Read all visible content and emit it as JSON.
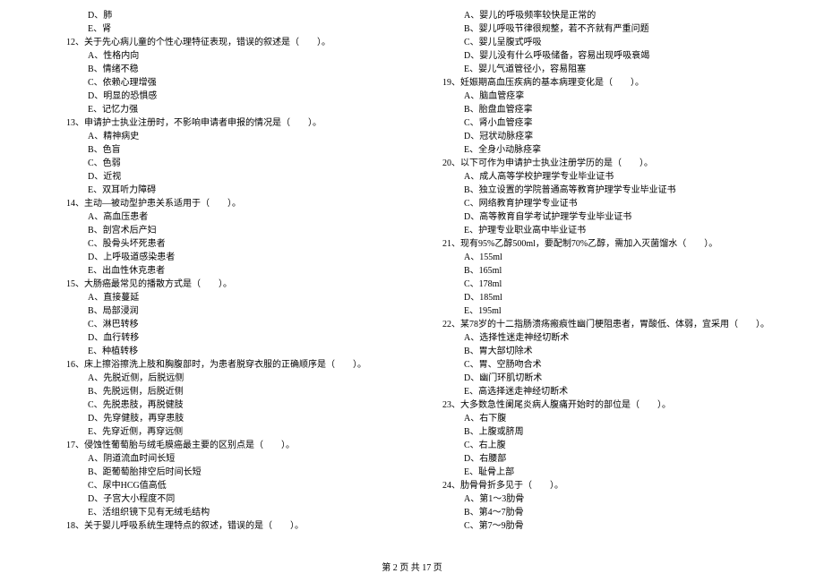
{
  "left_column": [
    {
      "type": "option",
      "text": "D、肺"
    },
    {
      "type": "option",
      "text": "E、肾"
    },
    {
      "type": "question",
      "text": "12、关于先心病儿童的个性心理特征表现，错误的叙述是（　　）。"
    },
    {
      "type": "option",
      "text": "A、性格内向"
    },
    {
      "type": "option",
      "text": "B、情绪不稳"
    },
    {
      "type": "option",
      "text": "C、依赖心理增强"
    },
    {
      "type": "option",
      "text": "D、明显的恐惧感"
    },
    {
      "type": "option",
      "text": "E、记忆力强"
    },
    {
      "type": "question",
      "text": "13、申请护士执业注册时，不影响申请者申报的情况是（　　）。"
    },
    {
      "type": "option",
      "text": "A、精神病史"
    },
    {
      "type": "option",
      "text": "B、色盲"
    },
    {
      "type": "option",
      "text": "C、色弱"
    },
    {
      "type": "option",
      "text": "D、近视"
    },
    {
      "type": "option",
      "text": "E、双耳听力障碍"
    },
    {
      "type": "question",
      "text": "14、主动—被动型护患关系适用于（　　）。"
    },
    {
      "type": "option",
      "text": "A、高血压患者"
    },
    {
      "type": "option",
      "text": "B、剖宫术后产妇"
    },
    {
      "type": "option",
      "text": "C、股骨头坏死患者"
    },
    {
      "type": "option",
      "text": "D、上呼吸道感染患者"
    },
    {
      "type": "option",
      "text": "E、出血性休克患者"
    },
    {
      "type": "question",
      "text": "15、大肠癌最常见的播散方式是（　　）。"
    },
    {
      "type": "option",
      "text": "A、直接蔓延"
    },
    {
      "type": "option",
      "text": "B、局部浸润"
    },
    {
      "type": "option",
      "text": "C、淋巴转移"
    },
    {
      "type": "option",
      "text": "D、血行转移"
    },
    {
      "type": "option",
      "text": "E、种植转移"
    },
    {
      "type": "question",
      "text": "16、床上擦浴擦洗上肢和胸腹部时，为患者脱穿衣服的正确顺序是（　　）。"
    },
    {
      "type": "option",
      "text": "A、先脱近侧，后脱远侧"
    },
    {
      "type": "option",
      "text": "B、先脱远侧，后脱近侧"
    },
    {
      "type": "option",
      "text": "C、先脱患肢，再脱健肢"
    },
    {
      "type": "option",
      "text": "D、先穿健肢，再穿患肢"
    },
    {
      "type": "option",
      "text": "E、先穿近侧，再穿远侧"
    },
    {
      "type": "question",
      "text": "17、侵蚀性葡萄胎与绒毛膜癌最主要的区别点是（　　）。"
    },
    {
      "type": "option",
      "text": "A、阴道流血时间长短"
    },
    {
      "type": "option",
      "text": "B、距葡萄胎排空后时间长短"
    },
    {
      "type": "option",
      "text": "C、尿中HCG值高低"
    },
    {
      "type": "option",
      "text": "D、子宫大小程度不同"
    },
    {
      "type": "option",
      "text": "E、活组织镜下见有无绒毛结构"
    },
    {
      "type": "question",
      "text": "18、关于婴儿呼吸系统生理特点的叙述，错误的是（　　）。"
    }
  ],
  "right_column": [
    {
      "type": "option",
      "text": "A、婴儿的呼吸频率较快是正常的"
    },
    {
      "type": "option",
      "text": "B、婴儿呼吸节律很规整，若不齐就有严重问题"
    },
    {
      "type": "option",
      "text": "C、婴儿呈腹式呼吸"
    },
    {
      "type": "option",
      "text": "D、婴儿没有什么呼吸储备，容易出现呼吸衰竭"
    },
    {
      "type": "option",
      "text": "E、婴儿气道管径小，容易阻塞"
    },
    {
      "type": "question",
      "text": "19、妊娠期高血压疾病的基本病理变化是（　　）。"
    },
    {
      "type": "option",
      "text": "A、脑血管痉挛"
    },
    {
      "type": "option",
      "text": "B、胎盘血管痉挛"
    },
    {
      "type": "option",
      "text": "C、肾小血管痉挛"
    },
    {
      "type": "option",
      "text": "D、冠状动脉痉挛"
    },
    {
      "type": "option",
      "text": "E、全身小动脉痉挛"
    },
    {
      "type": "question",
      "text": "20、以下可作为申请护士执业注册学历的是（　　）。"
    },
    {
      "type": "option",
      "text": "A、成人高等学校护理学专业毕业证书"
    },
    {
      "type": "option",
      "text": "B、独立设置的学院普通高等教育护理学专业毕业证书"
    },
    {
      "type": "option",
      "text": "C、网络教育护理学专业证书"
    },
    {
      "type": "option",
      "text": "D、高等教育自学考试护理学专业毕业证书"
    },
    {
      "type": "option",
      "text": "E、护理专业职业高中毕业证书"
    },
    {
      "type": "question",
      "text": "21、现有95%乙醇500ml，要配制70%乙醇，需加入灭菌馏水（　　）。"
    },
    {
      "type": "option",
      "text": "A、155ml"
    },
    {
      "type": "option",
      "text": "B、165ml"
    },
    {
      "type": "option",
      "text": "C、178ml"
    },
    {
      "type": "option",
      "text": "D、185ml"
    },
    {
      "type": "option",
      "text": "E、195ml"
    },
    {
      "type": "question",
      "text": "22、某78岁的十二指肠溃疡瘢痕性幽门梗阻患者，胃酸低、体弱，宜采用（　　）。"
    },
    {
      "type": "option",
      "text": "A、选择性迷走神经切断术"
    },
    {
      "type": "option",
      "text": "B、胃大部切除术"
    },
    {
      "type": "option",
      "text": "C、胃、空肠吻合术"
    },
    {
      "type": "option",
      "text": "D、幽门环肌切断术"
    },
    {
      "type": "option",
      "text": "E、高选择迷走神经切断术"
    },
    {
      "type": "question",
      "text": "23、大多数急性阑尾炎病人腹痛开始时的部位是（　　）。"
    },
    {
      "type": "option",
      "text": "A、右下腹"
    },
    {
      "type": "option",
      "text": "B、上腹或脐周"
    },
    {
      "type": "option",
      "text": "C、右上腹"
    },
    {
      "type": "option",
      "text": "D、右腰部"
    },
    {
      "type": "option",
      "text": "E、耻骨上部"
    },
    {
      "type": "question",
      "text": "24、肋骨骨折多见于（　　）。"
    },
    {
      "type": "option",
      "text": "A、第1～3肋骨"
    },
    {
      "type": "option",
      "text": "B、第4～7肋骨"
    },
    {
      "type": "option",
      "text": "C、第7～9肋骨"
    }
  ],
  "footer": "第 2 页 共 17 页"
}
